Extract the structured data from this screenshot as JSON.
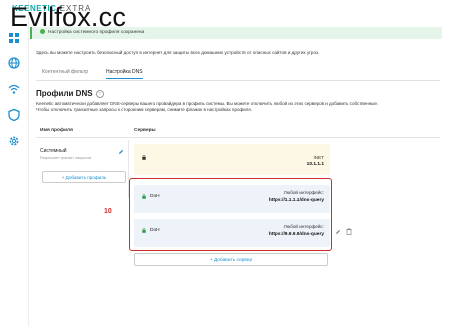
{
  "watermark": "Evilfox.cc",
  "brand": {
    "name": "KEENETIC",
    "suffix": "EXTRA"
  },
  "sidebar": {
    "items": [
      {
        "icon": "dashboard-icon"
      },
      {
        "icon": "globe-icon"
      },
      {
        "icon": "wifi-icon"
      },
      {
        "icon": "shield-icon",
        "active": true
      },
      {
        "icon": "gear-icon"
      }
    ]
  },
  "toast": {
    "text": "Настройка системного профиля сохранена"
  },
  "intro": {
    "text": "Здесь вы можете настроить безопасный доступ в интернет для защиты всех домашних устройств от опасных сайтов и других угроз."
  },
  "tabs": [
    {
      "label": "Контентный фильтр",
      "active": false
    },
    {
      "label": "Настройка DNS",
      "active": true
    }
  ],
  "section": {
    "title": "Профили DNS",
    "help": "?",
    "description_line1": "Keenetic автоматически добавляет DNS-серверы вашего провайдера в профиль системы. Вы можете отключить любой из этих серверов и добавить собственные.",
    "description_line2": "Чтобы отключить транзитные запросы к сторонним серверам, снимите флажок в настройках профиля."
  },
  "table": {
    "col_profile": "Имя профиля",
    "col_servers": "Серверы"
  },
  "profile": {
    "name": "Системный",
    "subtitle": "Разрешает транзит запросов",
    "add_button": "+ Добавить профиль"
  },
  "servers": [
    {
      "label": "",
      "iface": "INET",
      "address": "10.1.1.1"
    },
    {
      "label": "DoH",
      "iface": "Любой интерфейс:",
      "address": "https://1.1.1.1/dns-query"
    },
    {
      "label": "DoH",
      "iface": "Любой интерфейс:",
      "address": "https://9.9.9.9/dns-query"
    }
  ],
  "callout": "10",
  "add_server_button": "+ Добавить сервер",
  "colors": {
    "accent": "#1a8fd1",
    "highlight": "#d02a2a",
    "success": "#4caf50"
  }
}
